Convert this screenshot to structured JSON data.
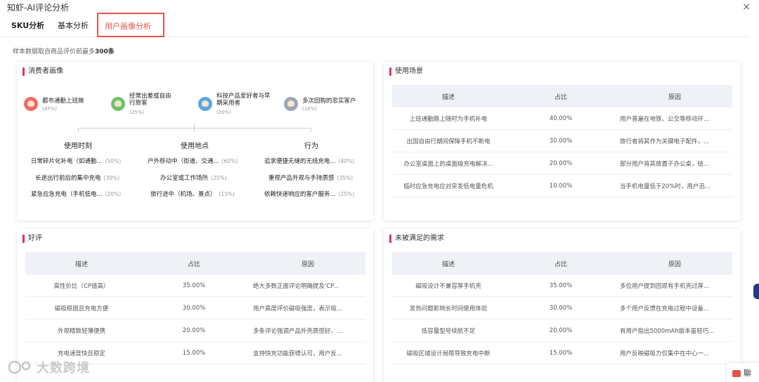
{
  "window": {
    "title": "知虾-AI评论分析",
    "close": "×"
  },
  "tabs": [
    "SKU分析",
    "基本分析",
    "用户画像分析"
  ],
  "sample_note": {
    "prefix": "样本数据取自商品评价前最多",
    "count": "300条"
  },
  "consumer": {
    "title": "消费者画像",
    "personas": [
      {
        "name": "都市通勤上班族",
        "pct": "(45%)",
        "color": "#f06a6a"
      },
      {
        "name": "经常出差或自由行旅客",
        "pct": "(25%)",
        "color": "#6cc46b"
      },
      {
        "name": "科技产品爱好者与早期采用者",
        "pct": "(20%)",
        "color": "#5aa7e6"
      },
      {
        "name": "多次回购的忠实客户",
        "pct": "(10%)",
        "color": "#9aa7b8"
      }
    ],
    "groups": [
      {
        "title": "使用时刻",
        "items": [
          {
            "text": "日常碎片化补电（如通勤...",
            "pct": "(50%)"
          },
          {
            "text": "长途出行前后的集中充电",
            "pct": "(30%)"
          },
          {
            "text": "紧急应急充电（手机低电...",
            "pct": "(20%)"
          }
        ]
      },
      {
        "title": "使用地点",
        "items": [
          {
            "text": "户外移动中（街道、交通...",
            "pct": "(60%)"
          },
          {
            "text": "办公室或工作场所",
            "pct": "(25%)"
          },
          {
            "text": "旅行途中（机场、景点）",
            "pct": "(15%)"
          }
        ]
      },
      {
        "title": "行为",
        "items": [
          {
            "text": "追求便捷无缝的无线充电...",
            "pct": "(40%)"
          },
          {
            "text": "重视产品外观与手持质感",
            "pct": "(35%)"
          },
          {
            "text": "依赖快速响应的客户服务...",
            "pct": "(25%)"
          }
        ]
      }
    ]
  },
  "scenes": {
    "title": "使用场景",
    "headers": [
      "描述",
      "占比",
      "原因"
    ],
    "rows": [
      [
        "上班通勤路上随时为手机补电",
        "40.00%",
        "用户普遍在地铁、公交等移动环..."
      ],
      [
        "出国自由行期间保障手机不断电",
        "30.00%",
        "旅行者将其作为关键电子配件，..."
      ],
      [
        "办公室桌面上的桌面级充电解决...",
        "20.00%",
        "部分用户将其放置于办公桌，结..."
      ],
      [
        "临时应急充电应对突发低电量危机",
        "10.00%",
        "当手机电量低于20%时，用户迅..."
      ]
    ]
  },
  "positive": {
    "title": "好评",
    "headers": [
      "描述",
      "占比",
      "原因"
    ],
    "rows": [
      [
        "高性价比（CP值高）",
        "35.00%",
        "绝大多数正面评论明确提及'CP..."
      ],
      [
        "磁吸稳固且充电方便",
        "30.00%",
        "用户高度评价磁吸强度，表示吸..."
      ],
      [
        "外观精致轻薄便携",
        "20.00%",
        "多条评论强调产品外壳质感好、..."
      ],
      [
        "充电速度快且稳定",
        "15.00%",
        "支持快充功能获得认可，用户反..."
      ]
    ]
  },
  "unmet": {
    "title": "未被满足的需求",
    "headers": [
      "描述",
      "占比",
      "原因"
    ],
    "rows": [
      [
        "磁吸设计不兼容厚手机壳",
        "35.00%",
        "多位用户提到因现有手机壳过厚..."
      ],
      [
        "发热问题影响长时间使用体验",
        "30.00%",
        "多个用户反馈在充电过程中设备..."
      ],
      [
        "低容量型号续航不足",
        "20.00%",
        "有用户指出5000mAh版本虽轻巧..."
      ],
      [
        "磁吸区域设计局限导致充电中断",
        "15.00%",
        "用户反映磁吸力仅集中在中心一..."
      ]
    ]
  },
  "watermark": "大数跨境",
  "chat": {
    "label": "聊"
  }
}
